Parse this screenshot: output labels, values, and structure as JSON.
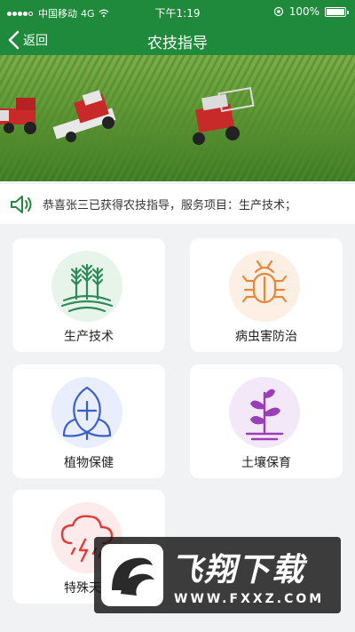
{
  "status_bar": {
    "carrier": "中国移动",
    "network": "4G",
    "time": "下午1:19",
    "battery": "100%",
    "signal_bars": 4
  },
  "nav": {
    "back_label": "返回",
    "title": "农技指导"
  },
  "notice": {
    "text": "恭喜张三已获得农技指导，服务项目：生产技术；",
    "icon": "speaker-icon"
  },
  "cards": [
    {
      "label": "生产技术",
      "icon": "wheat-icon",
      "color": "#2e8b57"
    },
    {
      "label": "病虫害防治",
      "icon": "bug-icon",
      "color": "#e8873a"
    },
    {
      "label": "植物保健",
      "icon": "plant-health-icon",
      "color": "#3a5fcd"
    },
    {
      "label": "土壤保育",
      "icon": "sprout-icon",
      "color": "#9b3fb8"
    },
    {
      "label": "特殊天气",
      "icon": "storm-cloud-icon",
      "color": "#e23b3b"
    }
  ],
  "watermark": {
    "brand": "飞翔下载",
    "url": "WWW.FXXZ.COM"
  },
  "colors": {
    "primary": "#1f8a3b",
    "background": "#f1f2f4"
  }
}
